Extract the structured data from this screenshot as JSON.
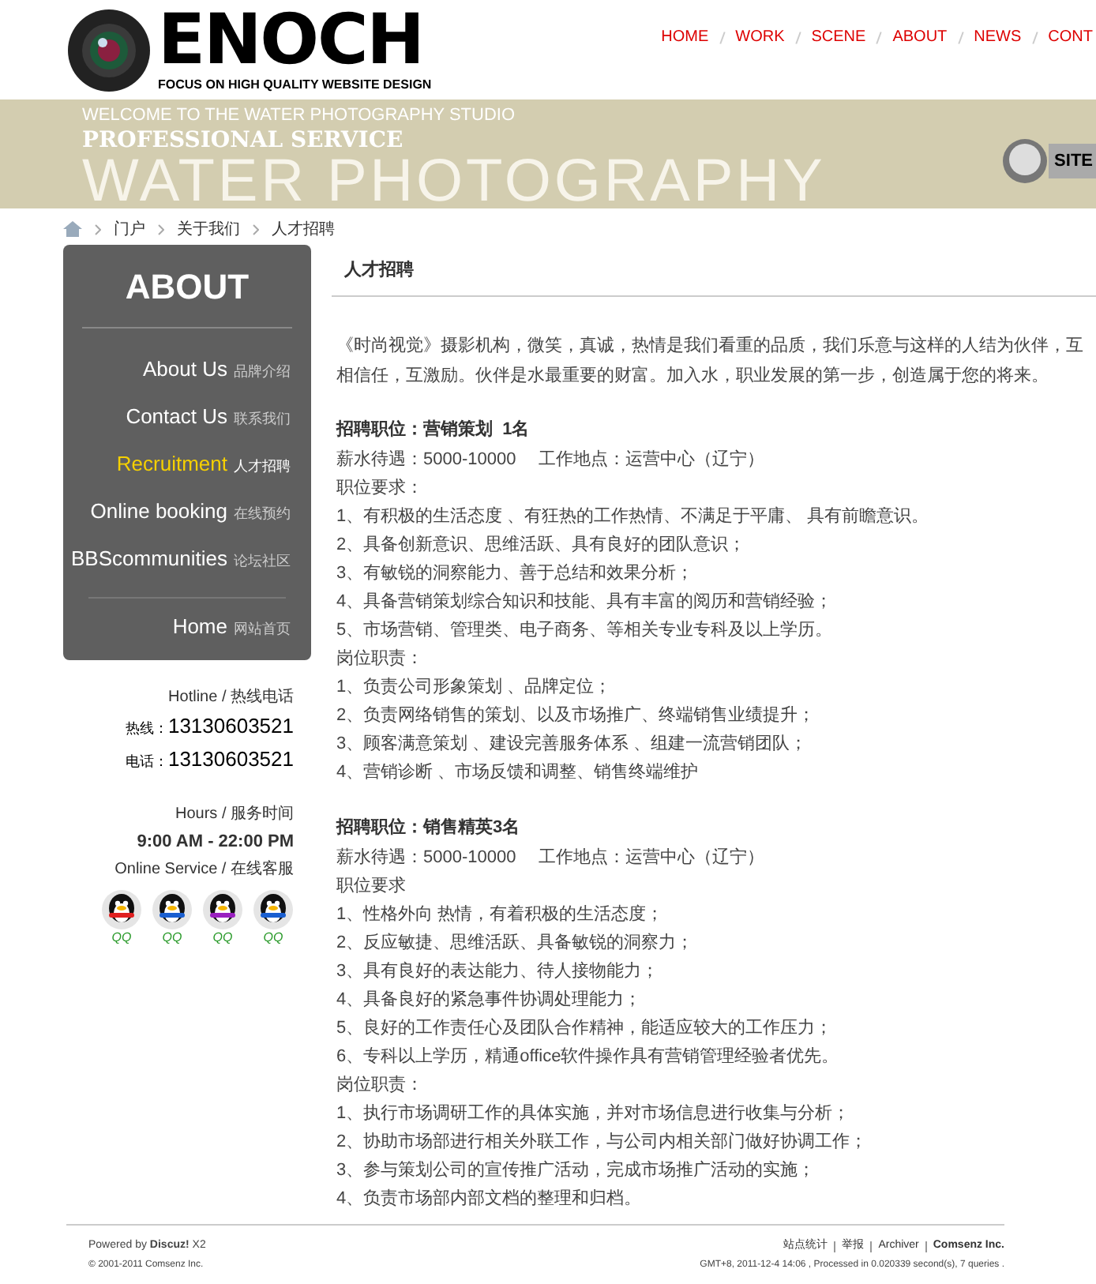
{
  "logo": {
    "name": "ENOCH",
    "tagline": "FOCUS ON HIGH QUALITY WEBSITE DESIGN"
  },
  "nav": [
    {
      "label": "HOME",
      "selected": false
    },
    {
      "label": "WORK",
      "selected": false
    },
    {
      "label": "SCENE",
      "selected": false
    },
    {
      "label": "ABOUT",
      "selected": false
    },
    {
      "label": "NEWS",
      "selected": false
    },
    {
      "label": "CONT",
      "selected": false
    }
  ],
  "banner": {
    "welcome": "WELCOME TO THE WATER PHOTOGRAPHY STUDIO",
    "headline": "PROFESSIONAL SERVICE",
    "big_text": "WATER PHOTOGRAPHY",
    "site_button": "SITE"
  },
  "breadcrumb": [
    "门户",
    "关于我们",
    "人才招聘"
  ],
  "sidebar": {
    "title": "ABOUT",
    "items": [
      {
        "label": "About Us",
        "sub": "品牌介绍",
        "selected": false
      },
      {
        "label": "Contact Us",
        "sub": "联系我们",
        "selected": false
      },
      {
        "label": "Recruitment",
        "sub": "人才招聘",
        "selected": true
      },
      {
        "label": "Online booking",
        "sub": "在线预约",
        "selected": false
      },
      {
        "label": "BBScommunities",
        "sub": "论坛社区",
        "selected": false
      }
    ],
    "home": {
      "label": "Home",
      "sub": "网站首页",
      "selected": false
    },
    "hotline_label": "Hotline / 热线电话",
    "phones": [
      {
        "label": "热线：",
        "number": "13130603521"
      },
      {
        "label": "电话：",
        "number": "13130603521"
      }
    ],
    "hours_label": "Hours / 服务时间",
    "hours": "9:00 AM - 22:00 PM",
    "service_label": "Online Service / 在线客服",
    "qq": [
      {
        "label": "QQ",
        "color": "#e02020"
      },
      {
        "label": "QQ",
        "color": "#1a5fd0"
      },
      {
        "label": "QQ",
        "color": "#9a20c0"
      },
      {
        "label": "QQ",
        "color": "#1a5fd0"
      }
    ]
  },
  "content": {
    "title": "人才招聘",
    "intro": "《时尚视觉》摄影机构，微笑，真诚，热情是我们看重的品质，我们乐意与这样的人结为伙伴，互相信任，互激励。伙伴是水最重要的财富。加入水，职业发展的第一步，创造属于您的将来。",
    "jobs": [
      {
        "title": "招聘职位：营销策划  1名",
        "salary": "薪水待遇：5000-10000　 工作地点：运营中心（辽宁）",
        "req_label": "职位要求：",
        "requirements": [
          "1、有积极的生活态度 、有狂热的工作热情、不满足于平庸、 具有前瞻意识。",
          "2、具备创新意识、思维活跃、具有良好的团队意识；",
          "3、有敏锐的洞察能力、善于总结和效果分析；",
          "4、具备营销策划综合知识和技能、具有丰富的阅历和营销经验；",
          "5、市场营销、管理类、电子商务、等相关专业专科及以上学历。"
        ],
        "duty_label": "岗位职责：",
        "duties": [
          "1、负责公司形象策划 、品牌定位；",
          "2、负责网络销售的策划、以及市场推广、终端销售业绩提升；",
          "3、顾客满意策划 、建设完善服务体系 、组建一流营销团队；",
          "4、营销诊断 、市场反馈和调整、销售终端维护"
        ]
      },
      {
        "title": "招聘职位：销售精英3名",
        "salary": "薪水待遇：5000-10000　 工作地点：运营中心（辽宁）",
        "req_label": "职位要求",
        "requirements": [
          "1、性格外向 热情，有着积极的生活态度；",
          "2、反应敏捷、思维活跃、具备敏锐的洞察力；",
          "3、具有良好的表达能力、待人接物能力；",
          "4、具备良好的紧急事件协调处理能力；",
          "5、良好的工作责任心及团队合作精神，能适应较大的工作压力；",
          "6、专科以上学历，精通office软件操作具有营销管理经验者优先。"
        ],
        "duty_label": "岗位职责：",
        "duties": [
          "1、执行市场调研工作的具体实施，并对市场信息进行收集与分析；",
          "2、协助市场部进行相关外联工作，与公司内相关部门做好协调工作；",
          "3、参与策划公司的宣传推广活动，完成市场推广活动的实施；",
          "4、负责市场部内部文档的整理和归档。"
        ]
      }
    ]
  },
  "footer": {
    "powered": "Powered by **Discuz!** X2",
    "copyright": "© 2001-2011 Comsenz Inc.",
    "links": [
      "站点统计",
      "举报",
      "Archiver",
      "Comsenz Inc."
    ],
    "stats": "GMT+8, 2011-12-4 14:06 , Processed in 0.020339 second(s), 7 queries ."
  }
}
